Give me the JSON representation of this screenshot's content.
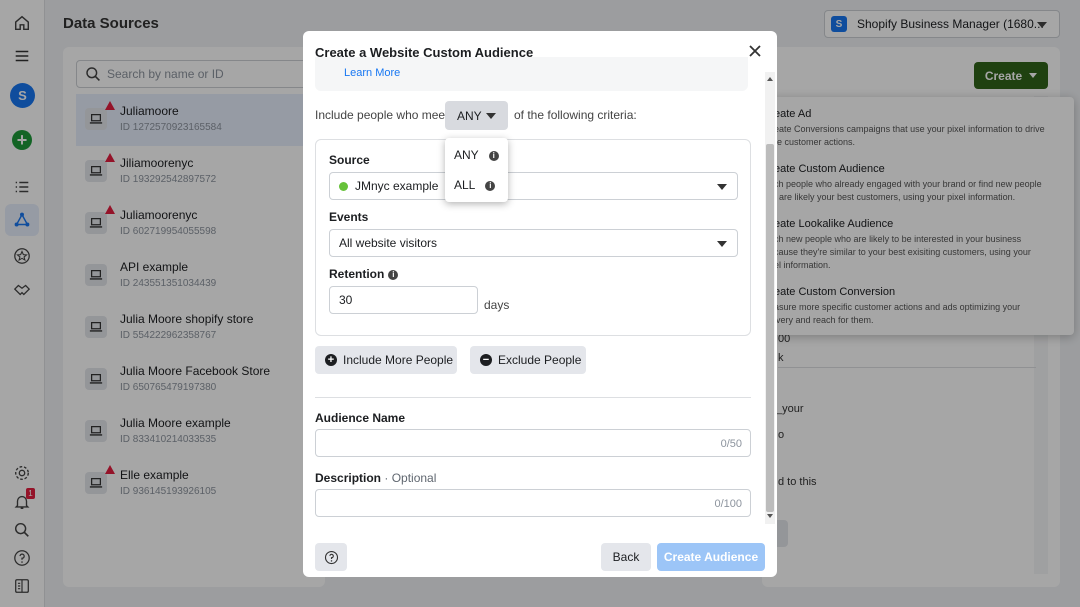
{
  "page": {
    "title": "Data Sources"
  },
  "business_selector": {
    "initial": "S",
    "label": "Shopify Business Manager (1680..."
  },
  "sidebar": {
    "avatar_initial": "S",
    "plus_label": "+",
    "notification_count": "1"
  },
  "search": {
    "placeholder": "Search by name or ID"
  },
  "sources": [
    {
      "name": "Juliamoore",
      "id": "ID 1272570923165584"
    },
    {
      "name": "Jiliamoorenyc",
      "id": "ID 193292542897572"
    },
    {
      "name": "Juliamoorenyc",
      "id": "ID 602719954055598"
    },
    {
      "name": "API example",
      "id": "ID 243551351034439"
    },
    {
      "name": "Julia Moore shopify store",
      "id": "ID 554222962358767"
    },
    {
      "name": "Julia Moore Facebook Store",
      "id": "ID 650765479197380"
    },
    {
      "name": "Julia Moore example",
      "id": "ID 833410214033535"
    },
    {
      "name": "Elle example",
      "id": "ID 936145193926105"
    }
  ],
  "create_button": {
    "label": "Create"
  },
  "create_menu": [
    {
      "title": "eate Ad",
      "desc1": "eate Conversions campaigns that use your pixel information to drive",
      "desc2": "re customer actions."
    },
    {
      "title": "eate Custom Audience",
      "desc1": "ch people who already engaged with your brand or find new people",
      "desc2": "t are likely your best customers, using your pixel information."
    },
    {
      "title": "eate Lookalike Audience",
      "desc1": "ch new people who are likely to be interested in your business",
      "desc2": "cause they're similar to your best exisiting customers, using your",
      "desc3": "el information."
    },
    {
      "title": "eate Custom Conversion",
      "desc1": "asure more specific customer actions and ads optimizing your",
      "desc2": "ivery and reach for them."
    }
  ],
  "right_panel_fragments": {
    "f1": "00",
    "f2": "k",
    "f3": "_your",
    "f4": "o",
    "f5": "d to this"
  },
  "modal": {
    "title": "Create a Website Custom Audience",
    "learn_more": "Learn More",
    "criteria_prefix": "Include people who meet",
    "criteria_selected": "ANY",
    "criteria_suffix": "of the following criteria:",
    "criteria_options": [
      "ANY",
      "ALL"
    ],
    "source_label": "Source",
    "source_value": "JMnyc example",
    "events_label": "Events",
    "events_value": "All website visitors",
    "retention_label": "Retention",
    "retention_value": "30",
    "retention_unit": "days",
    "include_more": "Include More People",
    "exclude": "Exclude People",
    "audience_name_label": "Audience Name",
    "audience_name_counter": "0/50",
    "description_label": "Description",
    "description_optional": "· Optional",
    "description_counter": "0/100",
    "back": "Back",
    "create_audience": "Create Audience"
  },
  "colors": {
    "primary_blue": "#1877f2",
    "create_green": "#31651a",
    "disabled_blue": "#9cc5f7",
    "warning_red": "#e41e3f",
    "source_dot": "#67c23a"
  }
}
